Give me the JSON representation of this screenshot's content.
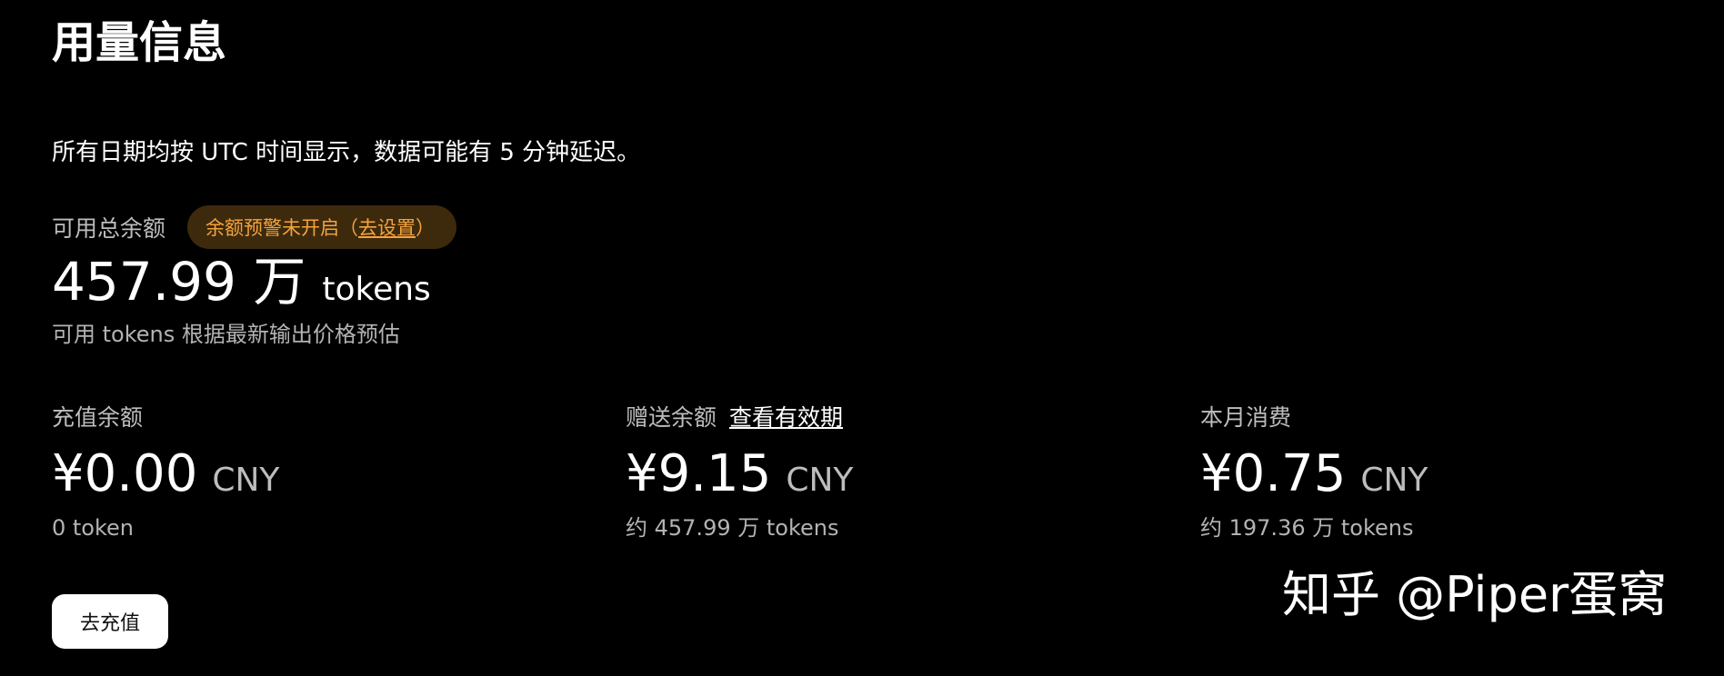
{
  "page": {
    "title": "用量信息",
    "notice": "所有日期均按 UTC 时间显示，数据可能有 5 分钟延迟。"
  },
  "total": {
    "label": "可用总余额",
    "warning_text": "余额预警未开启（",
    "warning_link": "去设置",
    "warning_close": "）",
    "value": "457.99 万",
    "unit": "tokens",
    "note": "可用 tokens 根据最新输出价格预估"
  },
  "cards": [
    {
      "label": "充值余额",
      "amount": "¥0.00",
      "currency": "CNY",
      "sub": "0 token"
    },
    {
      "label": "赠送余额",
      "link": "查看有效期",
      "amount": "¥9.15",
      "currency": "CNY",
      "sub": "约 457.99 万 tokens"
    },
    {
      "label": "本月消费",
      "amount": "¥0.75",
      "currency": "CNY",
      "sub": "约 197.36 万 tokens"
    }
  ],
  "actions": {
    "recharge_label": "去充值"
  },
  "watermark": "知乎 @Piper蛋窝",
  "colors": {
    "background": "#000000",
    "text": "#ffffff",
    "muted": "#bdbdbd",
    "warning_bg": "#3d2a0c",
    "warning_text": "#f4a340",
    "button_bg": "#ffffff"
  }
}
